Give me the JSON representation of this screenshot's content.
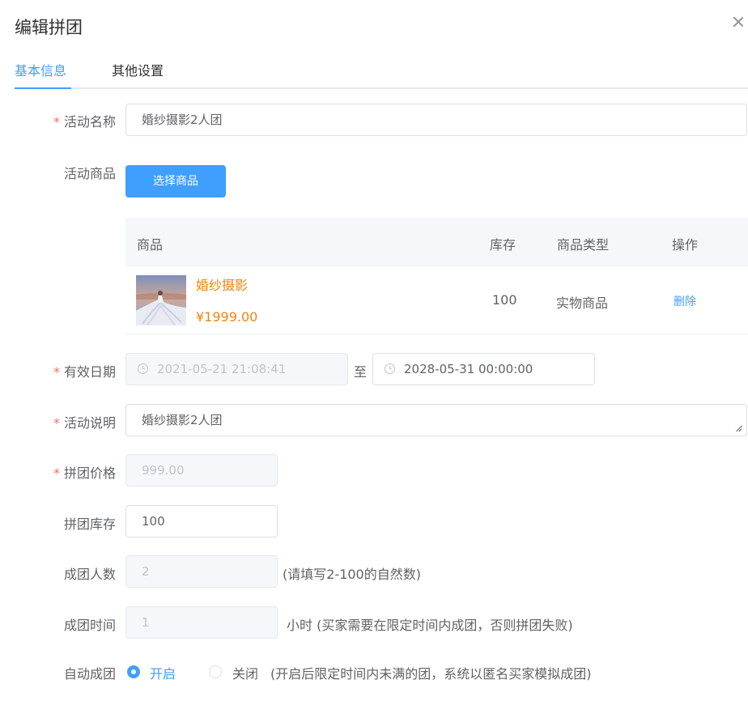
{
  "dialog": {
    "title": "编辑拼团"
  },
  "tabs": [
    {
      "label": "基本信息",
      "active": true
    },
    {
      "label": "其他设置",
      "active": false
    }
  ],
  "form": {
    "activity_name": {
      "label": "活动名称",
      "value": "婚纱摄影2人团"
    },
    "activity_product": {
      "label": "活动商品",
      "button": "选择商品"
    },
    "product_table": {
      "headers": [
        "商品",
        "库存",
        "商品类型",
        "操作"
      ],
      "rows": [
        {
          "name": "婚纱摄影",
          "price": "¥1999.00",
          "stock": "100",
          "type": "实物商品",
          "action": "删除"
        }
      ]
    },
    "valid_date": {
      "label": "有效日期",
      "start": "2021-05-21 21:08:41",
      "separator": "至",
      "end": "2028-05-31 00:00:00"
    },
    "description": {
      "label": "活动说明",
      "value": "婚纱摄影2人团"
    },
    "group_price": {
      "label": "拼团价格",
      "value": "999.00"
    },
    "group_stock": {
      "label": "拼团库存",
      "value": "100"
    },
    "group_size": {
      "label": "成团人数",
      "value": "2",
      "hint": "(请填写2-100的自然数)"
    },
    "group_time": {
      "label": "成团时间",
      "value": "1",
      "hint": "小时 (买家需要在限定时间内成团，否则拼团失败)"
    },
    "auto_group": {
      "label": "自动成团",
      "option_on": "开启",
      "option_off": "关闭",
      "hint": "(开启后限定时间内未满的团，系统以匿名买家模拟成团)",
      "selected": "开启"
    }
  },
  "colors": {
    "primary": "#409eff",
    "required": "#f56c6c",
    "price": "#f2840c"
  }
}
